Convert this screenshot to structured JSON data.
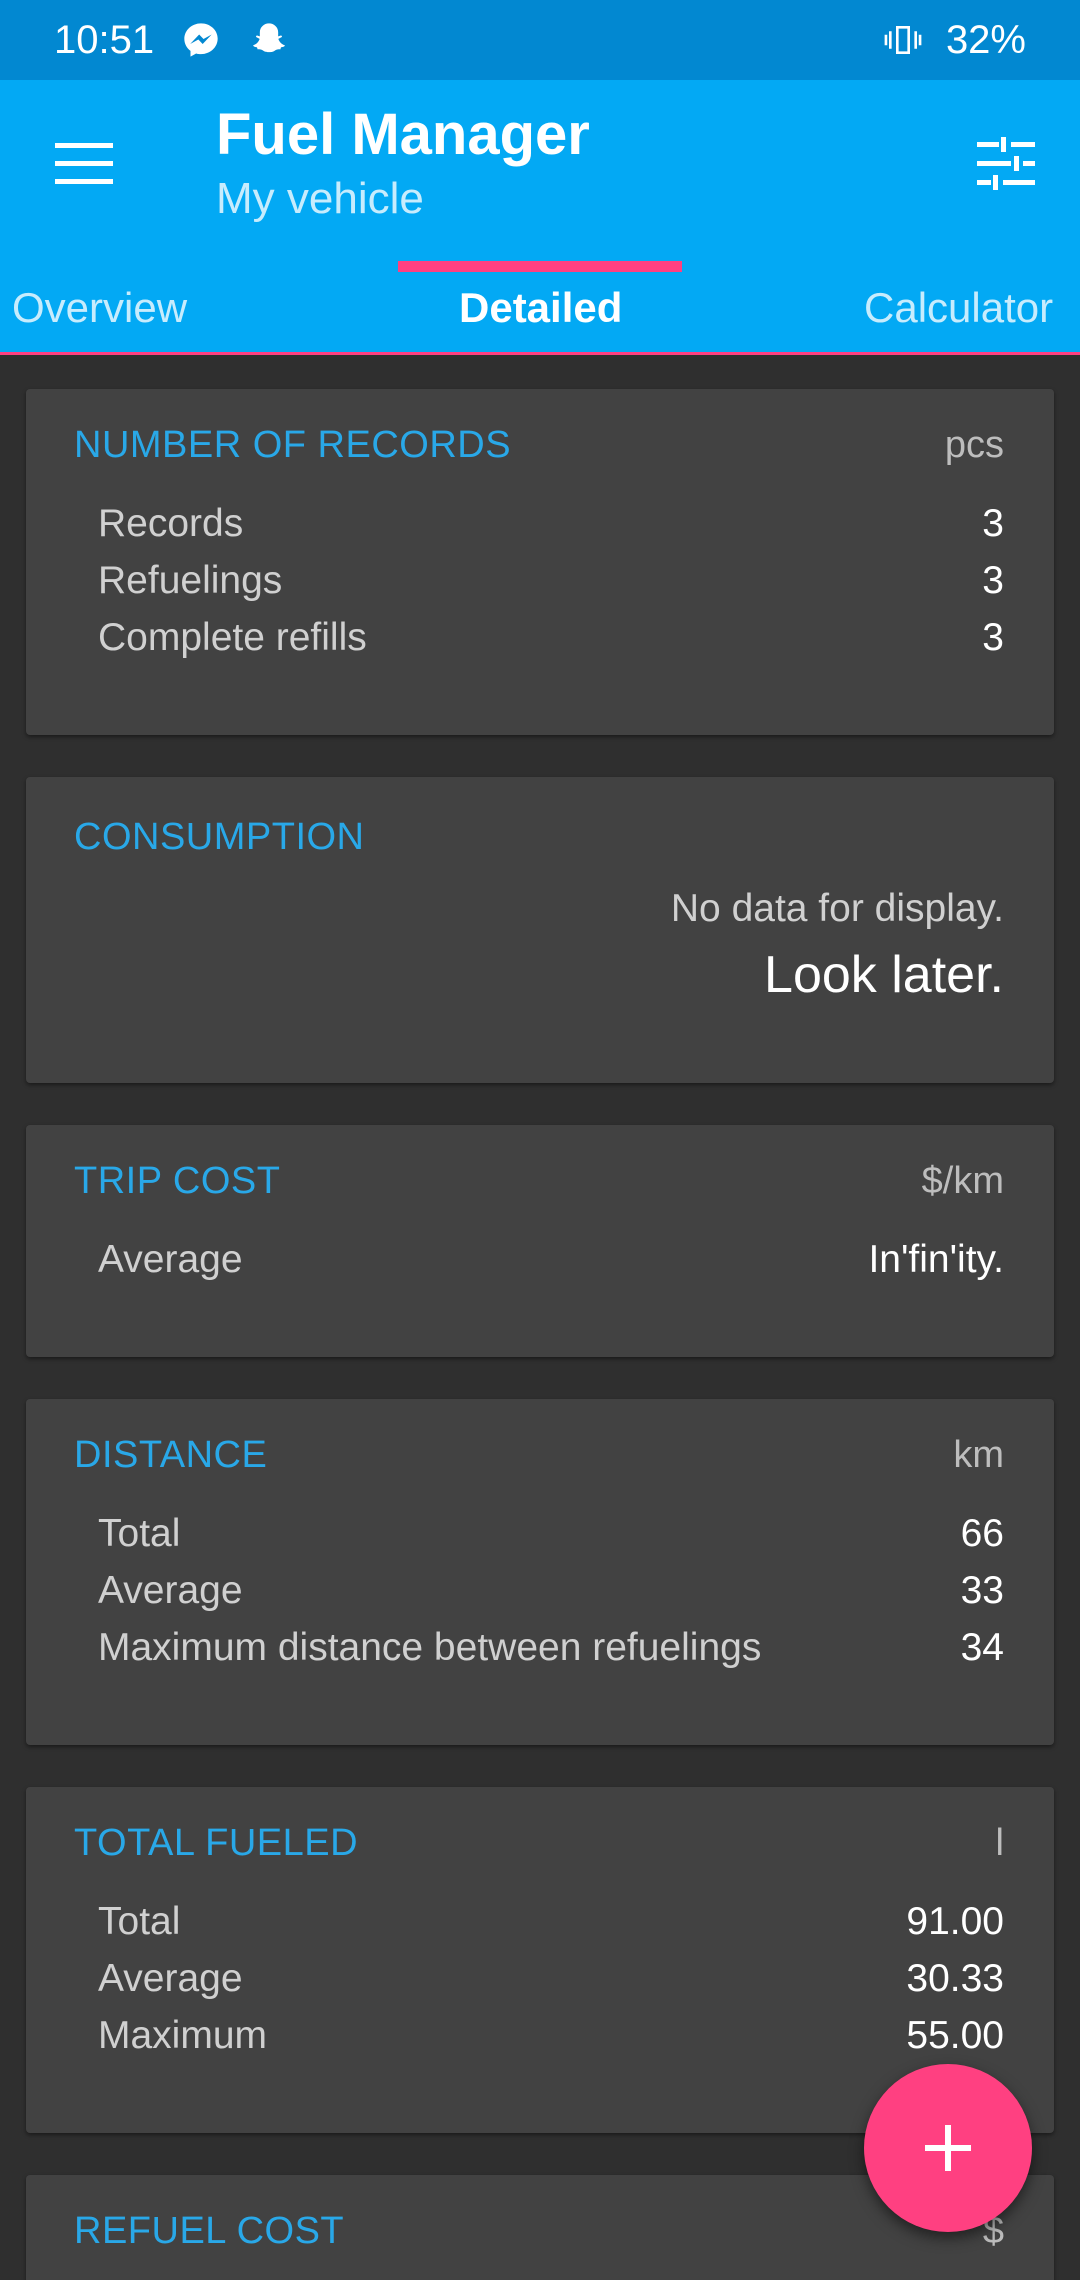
{
  "status_bar": {
    "time": "10:51",
    "battery": "32%",
    "icons": [
      "messenger-icon",
      "snapchat-icon",
      "vibrate-icon"
    ]
  },
  "app_bar": {
    "title": "Fuel Manager",
    "subtitle": "My vehicle",
    "menu_icon": "hamburger-menu-icon",
    "filter_icon": "tune-sliders-icon",
    "color": "#03a9f4"
  },
  "tabs": [
    {
      "label": "Overview"
    },
    {
      "label": "Detailed"
    },
    {
      "label": "Calculator"
    }
  ],
  "accent_color": "#ff4081",
  "cards": {
    "records": {
      "title": "NUMBER OF RECORDS",
      "unit": "pcs",
      "rows": [
        {
          "label": "Records",
          "value": "3"
        },
        {
          "label": "Refuelings",
          "value": "3"
        },
        {
          "label": "Complete refills",
          "value": "3"
        }
      ]
    },
    "consumption": {
      "title": "CONSUMPTION",
      "no_data": "No data for display.",
      "look_later": "Look later."
    },
    "trip_cost": {
      "title": "TRIP COST",
      "unit": "$/km",
      "rows": [
        {
          "label": "Average",
          "value": "In'fin'ity."
        }
      ]
    },
    "distance": {
      "title": "DISTANCE",
      "unit": "km",
      "rows": [
        {
          "label": "Total",
          "value": "66"
        },
        {
          "label": "Average",
          "value": "33"
        },
        {
          "label": "Maximum distance between refuelings",
          "value": "34"
        }
      ]
    },
    "total_fueled": {
      "title": "TOTAL FUELED",
      "unit": "l",
      "rows": [
        {
          "label": "Total",
          "value": "91.00"
        },
        {
          "label": "Average",
          "value": "30.33"
        },
        {
          "label": "Maximum",
          "value": "55.00"
        }
      ]
    },
    "refuel_cost": {
      "title": "REFUEL COST",
      "unit": "$"
    }
  },
  "fab": {
    "icon": "plus-icon"
  }
}
